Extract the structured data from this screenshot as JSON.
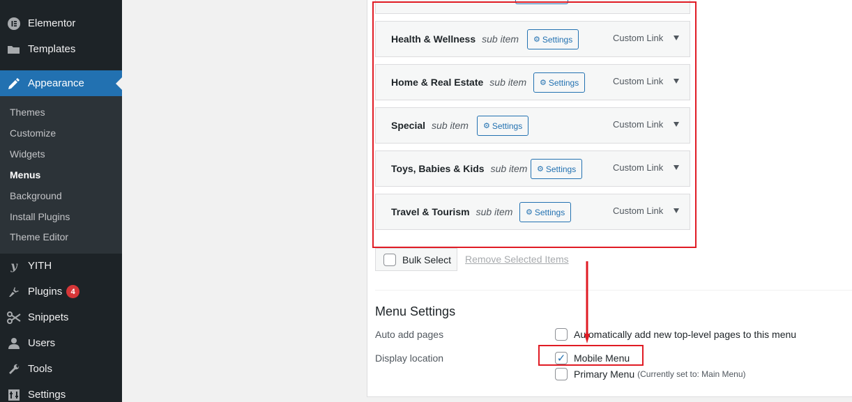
{
  "sidebar": {
    "top_items": [
      {
        "label": "Elementor",
        "icon": "elementor-icon"
      },
      {
        "label": "Templates",
        "icon": "folder-icon"
      }
    ],
    "active": {
      "label": "Appearance",
      "icon": "paintbrush-icon"
    },
    "submenu": [
      "Themes",
      "Customize",
      "Widgets",
      "Menus",
      "Background",
      "Install Plugins",
      "Theme Editor"
    ],
    "current_submenu": "Menus",
    "bottom_items": [
      {
        "label": "YITH",
        "icon": "yith-icon"
      },
      {
        "label": "Plugins",
        "icon": "plug-icon",
        "badge": "4"
      },
      {
        "label": "Snippets",
        "icon": "scissors-icon"
      },
      {
        "label": "Users",
        "icon": "user-icon"
      },
      {
        "label": "Tools",
        "icon": "wrench-icon"
      },
      {
        "label": "Settings",
        "icon": "sliders-icon"
      }
    ]
  },
  "menu_items": [
    {
      "title": "Health & Wellness",
      "sub": "sub item",
      "settings": "Settings",
      "type": "Custom Link"
    },
    {
      "title": "Home & Real Estate",
      "sub": "sub item",
      "settings": "Settings",
      "type": "Custom Link"
    },
    {
      "title": "Special",
      "sub": "sub item",
      "settings": "Settings",
      "type": "Custom Link"
    },
    {
      "title": "Toys, Babies & Kids",
      "sub": "sub item",
      "settings": "Settings",
      "type": "Custom Link"
    },
    {
      "title": "Travel & Tourism",
      "sub": "sub item",
      "settings": "Settings",
      "type": "Custom Link"
    }
  ],
  "bulk": {
    "label": "Bulk Select",
    "remove": "Remove Selected Items"
  },
  "menu_settings": {
    "title": "Menu Settings",
    "auto_add_label": "Auto add pages",
    "auto_add_option": "Automatically add new top-level pages to this menu",
    "display_label": "Display location",
    "locations": [
      {
        "label": "Mobile Menu",
        "checked": true,
        "note": ""
      },
      {
        "label": "Primary Menu",
        "checked": false,
        "note": "(Currently set to: Main Menu)"
      }
    ]
  },
  "colors": {
    "accent": "#2271b1",
    "annotation": "#e01b24",
    "sidebar": "#1d2327",
    "badge": "#d63638"
  }
}
